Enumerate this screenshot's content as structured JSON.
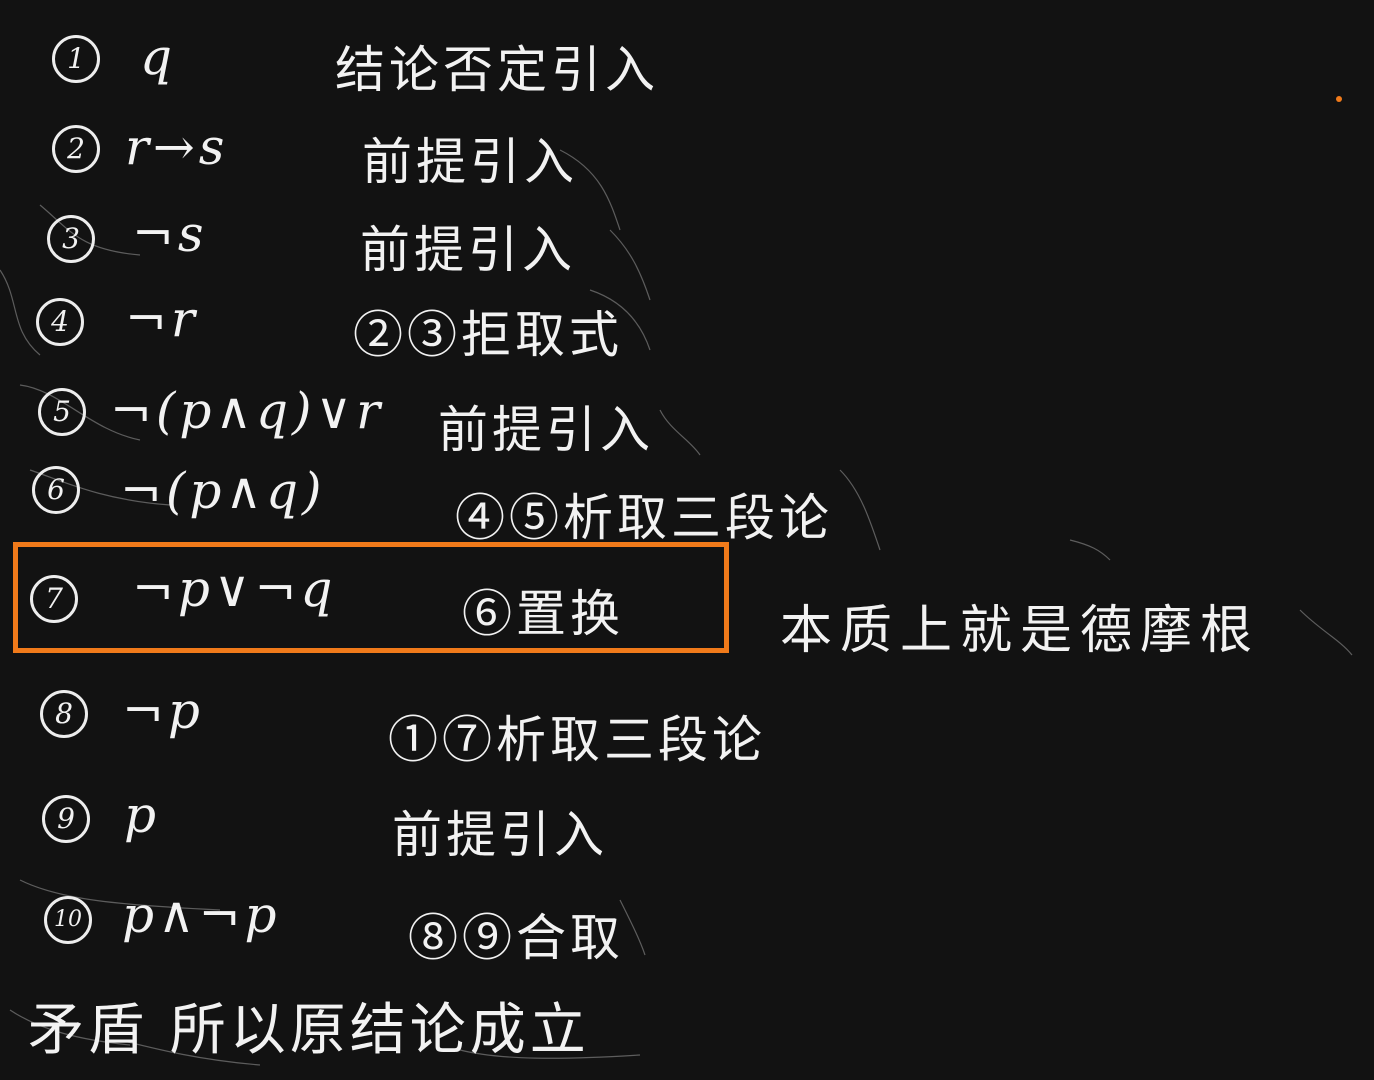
{
  "colors": {
    "background": "#121212",
    "ink": "#f2f2f2",
    "highlight": "#f07a1a"
  },
  "steps": [
    {
      "num": "1",
      "formula": "q",
      "reason": "结论否定引入"
    },
    {
      "num": "2",
      "formula": "r→s",
      "reason": "前提引入"
    },
    {
      "num": "3",
      "formula": "¬s",
      "reason": "前提引入"
    },
    {
      "num": "4",
      "formula": "¬r",
      "reason": "②③拒取式"
    },
    {
      "num": "5",
      "formula": "¬(p∧q)∨r",
      "reason": "前提引入"
    },
    {
      "num": "6",
      "formula": "¬(p∧q)",
      "reason": "④⑤析取三段论"
    },
    {
      "num": "7",
      "formula": "¬p∨¬q",
      "reason": "⑥置换"
    },
    {
      "num": "8",
      "formula": "¬p",
      "reason": "①⑦析取三段论"
    },
    {
      "num": "9",
      "formula": "p",
      "reason": "前提引入"
    },
    {
      "num": "10",
      "formula": "p∧¬p",
      "reason": "⑧⑨合取"
    }
  ],
  "note": "本质上就是德摩根",
  "conclusion": "矛盾  所以原结论成立"
}
